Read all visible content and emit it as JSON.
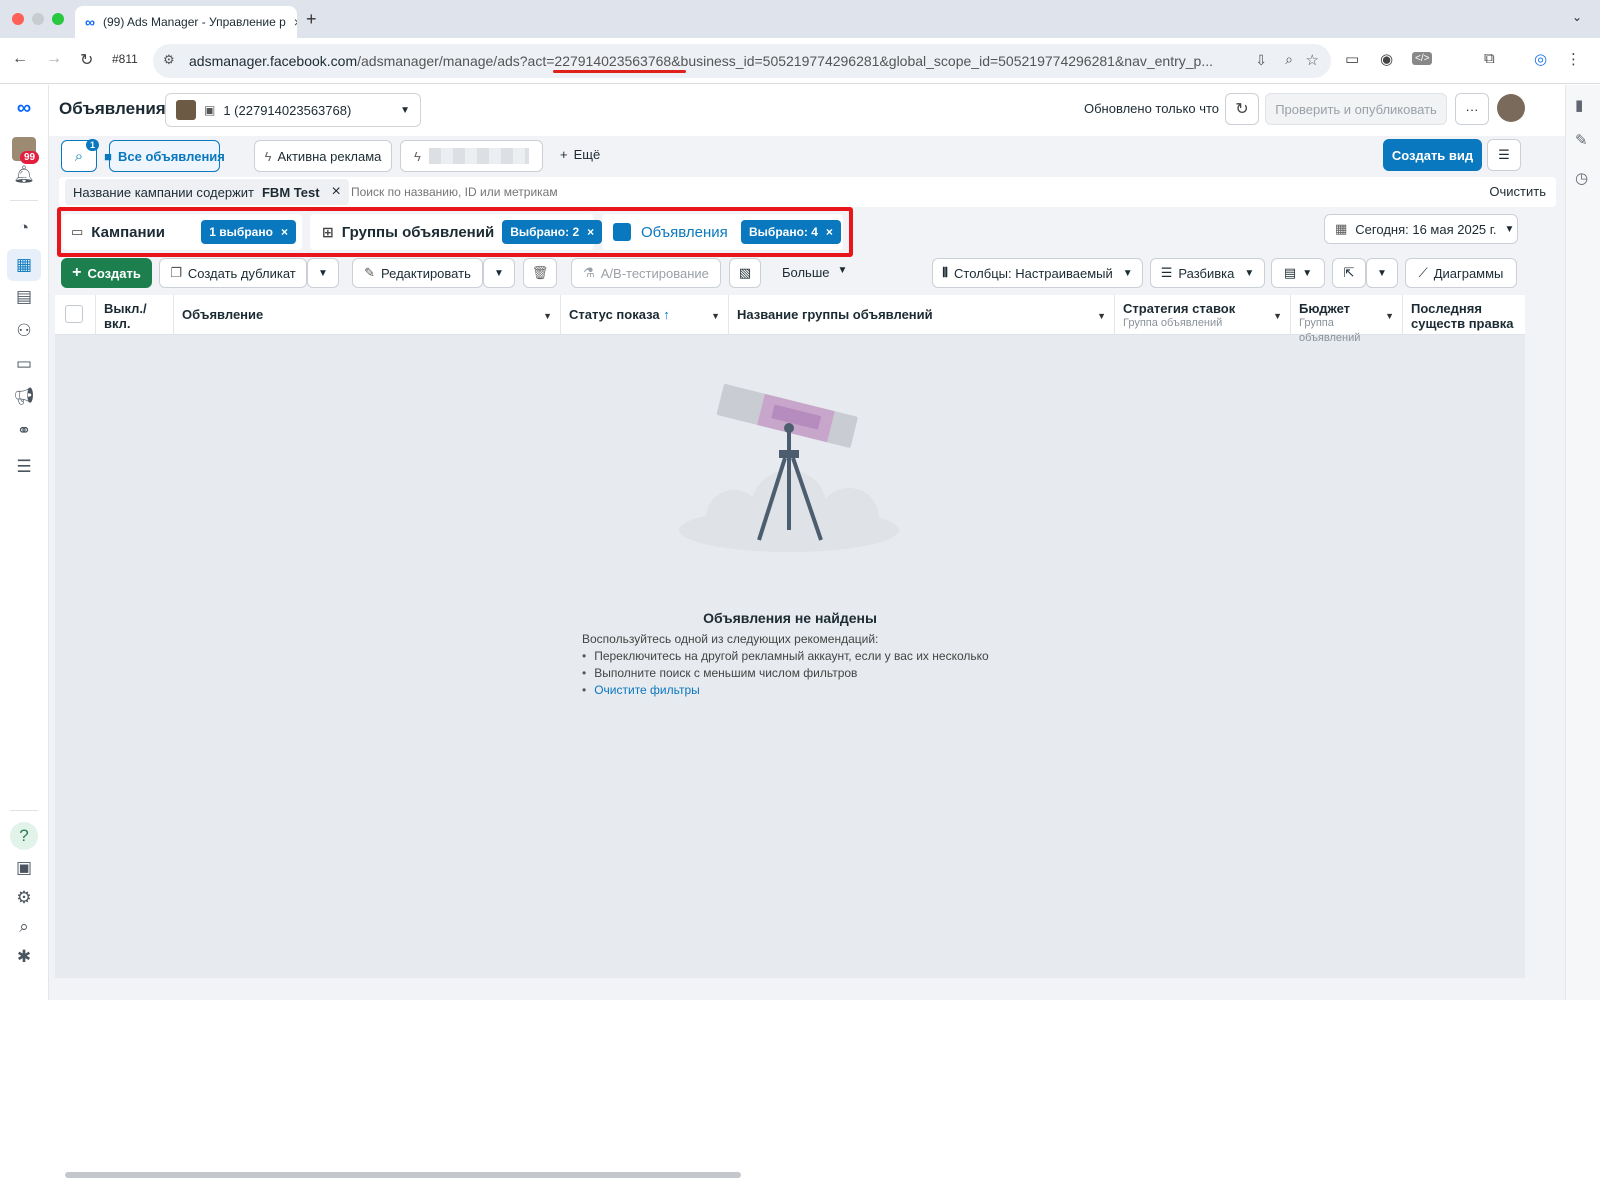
{
  "browser": {
    "tab_title": "(99) Ads Manager - Управление р",
    "url_prefix": "adsmanager.facebook.com",
    "url_rest": "/adsmanager/manage/ads?act=227914023563768&business_id=505219774296281&global_scope_id=505219774296281&nav_entry_p...",
    "history_count": "#811"
  },
  "header": {
    "title": "Объявления",
    "account_label": "1 (227914023563768)",
    "updated": "Обновлено только что",
    "publish": "Проверить и опубликовать",
    "more": "···"
  },
  "notifications": {
    "count": "99"
  },
  "toolbar1": {
    "search_badge": "1",
    "all_ads": "Все объявления",
    "active_ads": "Активна реклама",
    "more": "Ещё",
    "create_view": "Создать вид"
  },
  "filter": {
    "chip_prefix": "Название кампании содержит",
    "chip_value": "FBM Test",
    "placeholder": "Поиск по названию, ID или метрикам",
    "clear": "Очистить"
  },
  "levels": {
    "campaigns": "Кампании",
    "campaigns_badge": "1 выбрано",
    "adsets": "Группы объявлений",
    "adsets_badge": "Выбрано: 2",
    "ads": "Объявления",
    "ads_badge": "Выбрано: 4"
  },
  "date": "Сегодня: 16 мая 2025 г.",
  "toolbar2": {
    "create": "Создать",
    "duplicate": "Создать дубликат",
    "edit": "Редактировать",
    "ab_test": "A/B-тестирование",
    "more": "Больше",
    "columns": "Столбцы: Настраиваемый",
    "breakdown": "Разбивка",
    "charts": "Диаграммы"
  },
  "table": {
    "headers": {
      "toggle": "Выкл./ вкл.",
      "ad": "Объявление",
      "status": "Статус показа",
      "adset_name": "Название группы объявлений",
      "bid": "Стратегия ставок",
      "bid_sub": "Группа объявлений",
      "budget": "Бюджет",
      "budget_sub": "Группа объявлений",
      "last_edit": "Последняя существ правка"
    }
  },
  "empty": {
    "title": "Объявления не найдены",
    "intro": "Воспользуйтесь одной из следующих рекомендаций:",
    "tip1": "Переключитесь на другой рекламный аккаунт, если у вас их несколько",
    "tip2": "Выполните поиск с меньшим числом фильтров",
    "tip3": "Очистите фильтры"
  },
  "colors": {
    "accent": "#0a78be",
    "create_green": "#1d7f4e",
    "highlight_red": "#e8151b"
  }
}
